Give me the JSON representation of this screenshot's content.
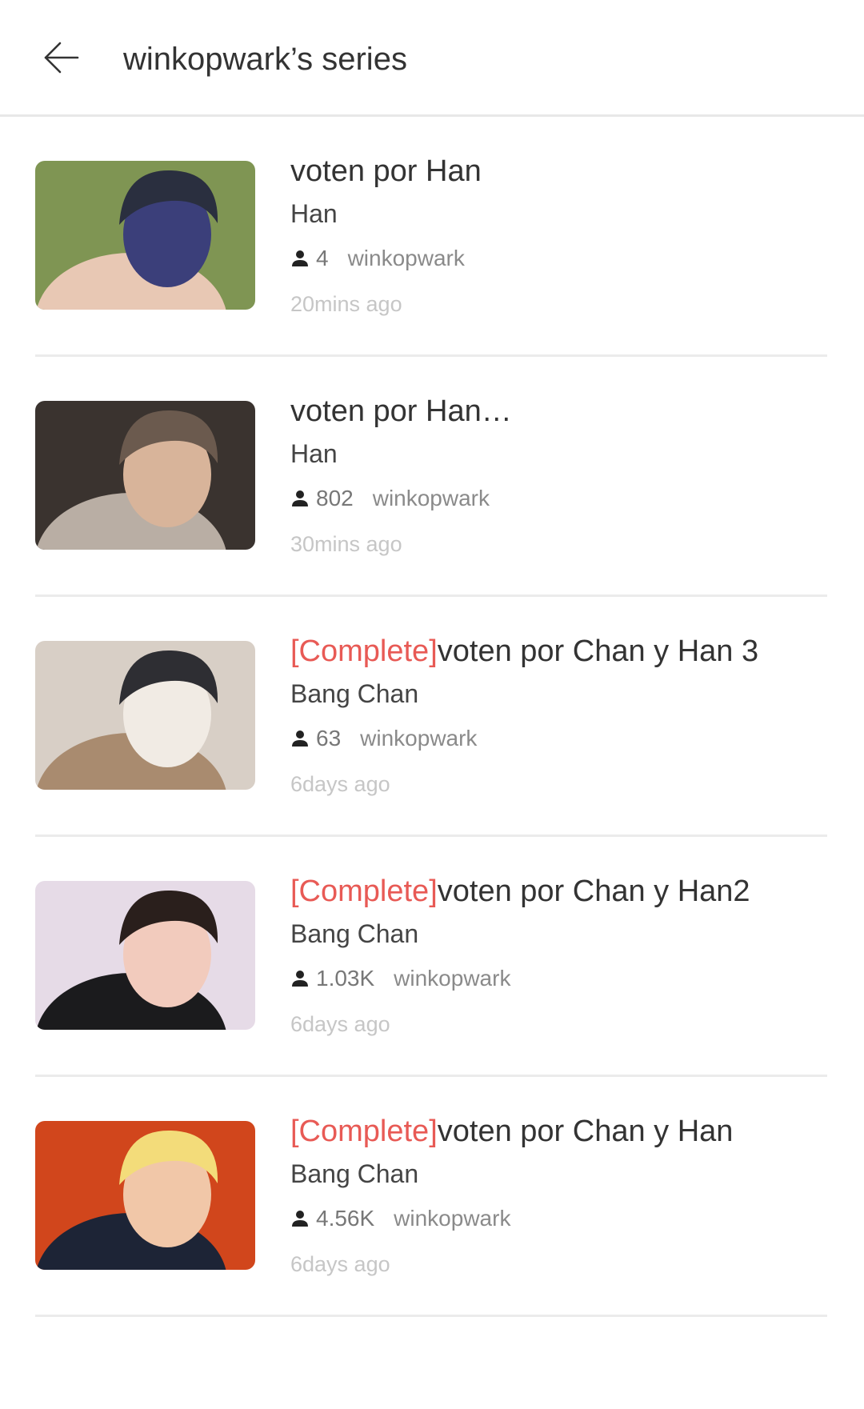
{
  "header": {
    "title": "winkopwark’s series",
    "back_icon": "arrow-left-icon"
  },
  "series": [
    {
      "tag": "",
      "title": "voten por Han",
      "author": "Han",
      "readers": "4",
      "username": "winkopwark",
      "time": "20mins ago",
      "cover_colors": [
        "#7f9553",
        "#2a2f3f",
        "#3b3f7a",
        "#e8c8b4"
      ]
    },
    {
      "tag": "",
      "title": "voten por Han…",
      "author": "Han",
      "readers": "802",
      "username": "winkopwark",
      "time": "30mins ago",
      "cover_colors": [
        "#3a332f",
        "#6b5a4e",
        "#d8b49a",
        "#b9aea4"
      ]
    },
    {
      "tag": "[Complete]",
      "title": "voten por Chan y Han 3",
      "author": "Bang Chan",
      "readers": "63",
      "username": "winkopwark",
      "time": "6days ago",
      "cover_colors": [
        "#d8cfc6",
        "#2e2e33",
        "#f1ebe4",
        "#a98b6f"
      ]
    },
    {
      "tag": "[Complete]",
      "title": "voten por Chan y Han2",
      "author": "Bang Chan",
      "readers": "1.03K",
      "username": "winkopwark",
      "time": "6days ago",
      "cover_colors": [
        "#e6dbe7",
        "#2a1f1c",
        "#f2cbbd",
        "#1b1b1d"
      ]
    },
    {
      "tag": "[Complete]",
      "title": "voten por Chan y Han",
      "author": "Bang Chan",
      "readers": "4.56K",
      "username": "winkopwark",
      "time": "6days ago",
      "cover_colors": [
        "#d1461c",
        "#f3dc7a",
        "#f1c7a8",
        "#1d2436"
      ]
    }
  ],
  "colors": {
    "tag": "#e85a55",
    "divider": "#ebebeb",
    "time": "#c6c6c6"
  }
}
